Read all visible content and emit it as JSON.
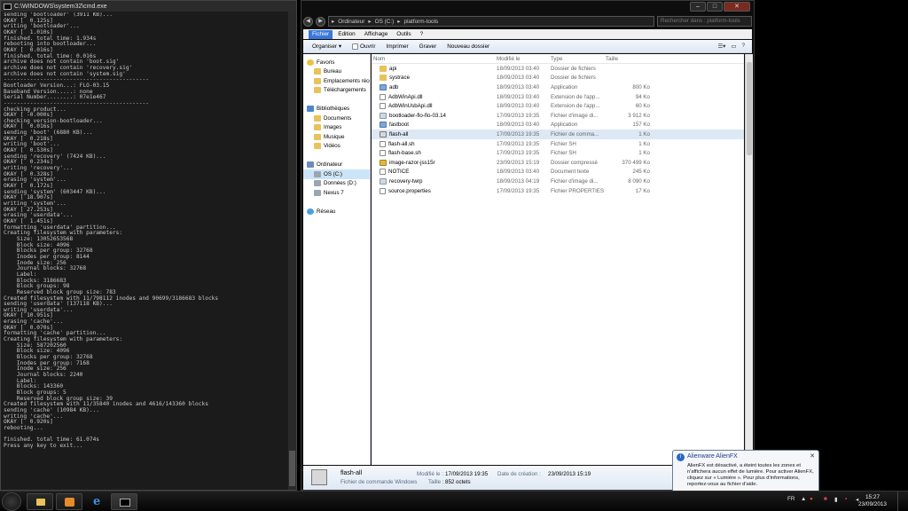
{
  "cmd": {
    "title": "C:\\WINDOWS\\system32\\cmd.exe",
    "lines": [
      "sending 'bootloader' (3911 KB)...",
      "OKAY [  0.125s]",
      "writing 'bootloader'...",
      "OKAY [  1.010s]",
      "finished. total time: 1.934s",
      "rebooting into bootloader...",
      "OKAY [  0.016s]",
      "finished. total time: 0.016s",
      "archive does not contain 'boot.sig'",
      "archive does not contain 'recovery.sig'",
      "archive does not contain 'system.sig'",
      "--------------------------------------------",
      "Bootloader Version...: FLO-03.15",
      "Baseband Version.....: none",
      "Serial Number........: 07e1e467",
      "--------------------------------------------",
      "checking product...",
      "OKAY [ -0.000s]",
      "checking version-bootloader...",
      "OKAY [  0.016s]",
      "sending 'boot' (6880 KB)...",
      "OKAY [  0.218s]",
      "writing 'boot'...",
      "OKAY [  0.530s]",
      "sending 'recovery' (7424 KB)...",
      "OKAY [  0.234s]",
      "writing 'recovery'...",
      "OKAY [  0.328s]",
      "erasing 'system'...",
      "OKAY [  0.172s]",
      "sending 'system' (603447 KB)...",
      "OKAY [ 18.907s]",
      "writing 'system'...",
      "OKAY [ 27.253s]",
      "erasing 'userdata'...",
      "OKAY [  1.451s]",
      "formatting 'userdata' partition...",
      "Creating filesystem with parameters:",
      "    Size: 13052653568",
      "    Block size: 4096",
      "    Blocks per group: 32768",
      "    Inodes per group: 8144",
      "    Inode size: 256",
      "    Journal blocks: 32768",
      "    Label:",
      "    Blocks: 3186683",
      "    Block groups: 98",
      "    Reserved block group size: 783",
      "Created filesystem with 11/798112 inodes and 90699/3186683 blocks",
      "sending 'userdata' (137118 KB)...",
      "writing 'userdata'...",
      "OKAY [ 10.951s]",
      "erasing 'cache'...",
      "OKAY [  0.070s]",
      "formatting 'cache' partition...",
      "Creating filesystem with parameters:",
      "    Size: 587202560",
      "    Block size: 4096",
      "    Blocks per group: 32768",
      "    Inodes per group: 7168",
      "    Inode size: 256",
      "    Journal blocks: 2240",
      "    Label:",
      "    Blocks: 143360",
      "    Block groups: 5",
      "    Reserved block group size: 39",
      "Created filesystem with 11/35840 inodes and 4616/143360 blocks",
      "sending 'cache' (10984 KB)...",
      "writing 'cache'...",
      "OKAY [  0.920s]",
      "rebooting...",
      "",
      "finished. total time: 61.074s",
      "Press any key to exit..."
    ]
  },
  "explorer": {
    "breadcrumb": [
      "Ordinateur",
      "OS (C:)",
      "platform-tools"
    ],
    "search_placeholder": "Rechercher dans : platform-tools",
    "menu": [
      "Fichier",
      "Edition",
      "Affichage",
      "Outils",
      "?"
    ],
    "toolbar": [
      "Organiser ▾",
      "Ouvrir",
      "Imprimer",
      "Graver",
      "Nouveau dossier"
    ],
    "nav": [
      {
        "label": "Favoris",
        "icon": "star-icon",
        "indent": 0
      },
      {
        "label": "Bureau",
        "icon": "folder-icon",
        "indent": 1
      },
      {
        "label": "Emplacements récents",
        "icon": "folder-icon",
        "indent": 1
      },
      {
        "label": "Téléchargements",
        "icon": "folder-icon",
        "indent": 1
      },
      {
        "label": "",
        "icon": "",
        "indent": 0
      },
      {
        "label": "Bibliothèques",
        "icon": "library-icon",
        "indent": 0
      },
      {
        "label": "Documents",
        "icon": "folder-icon",
        "indent": 1
      },
      {
        "label": "Images",
        "icon": "folder-icon",
        "indent": 1
      },
      {
        "label": "Musique",
        "icon": "folder-icon",
        "indent": 1
      },
      {
        "label": "Vidéos",
        "icon": "folder-icon",
        "indent": 1
      },
      {
        "label": "",
        "icon": "",
        "indent": 0
      },
      {
        "label": "Ordinateur",
        "icon": "computer-icon",
        "indent": 0
      },
      {
        "label": "OS (C:)",
        "icon": "drive-icon",
        "indent": 1,
        "selected": true
      },
      {
        "label": "Données (D:)",
        "icon": "drive-icon",
        "indent": 1
      },
      {
        "label": "Nexus 7",
        "icon": "drive-icon",
        "indent": 1
      },
      {
        "label": "",
        "icon": "",
        "indent": 0
      },
      {
        "label": "Réseau",
        "icon": "network-icon",
        "indent": 0
      }
    ],
    "columns": [
      "Nom",
      "Modifié le",
      "Type",
      "Taille"
    ],
    "files": [
      {
        "name": "api",
        "date": "18/09/2013 03:40",
        "type": "Dossier de fichiers",
        "size": "",
        "icon": "folder"
      },
      {
        "name": "systrace",
        "date": "18/09/2013 03:40",
        "type": "Dossier de fichiers",
        "size": "",
        "icon": "folder"
      },
      {
        "name": "adb",
        "date": "18/09/2013 03:40",
        "type": "Application",
        "size": "800 Ko",
        "icon": "app"
      },
      {
        "name": "AdbWinApi.dll",
        "date": "18/09/2013 03:40",
        "type": "Extension de l'app...",
        "size": "94 Ko",
        "icon": "doc"
      },
      {
        "name": "AdbWinUsbApi.dll",
        "date": "18/09/2013 03:40",
        "type": "Extension de l'app...",
        "size": "60 Ko",
        "icon": "doc"
      },
      {
        "name": "bootloader-flo-flo-03.14",
        "date": "17/09/2013 19:35",
        "type": "Fichier d'image di...",
        "size": "3 912 Ko",
        "icon": "img"
      },
      {
        "name": "fastboot",
        "date": "18/09/2013 03:40",
        "type": "Application",
        "size": "157 Ko",
        "icon": "app"
      },
      {
        "name": "flash-all",
        "date": "17/09/2013 19:35",
        "type": "Fichier de comma...",
        "size": "1 Ko",
        "icon": "bat",
        "selected": true
      },
      {
        "name": "flash-all.sh",
        "date": "17/09/2013 19:35",
        "type": "Fichier SH",
        "size": "1 Ko",
        "icon": "doc"
      },
      {
        "name": "flash-base.sh",
        "date": "17/09/2013 19:35",
        "type": "Fichier SH",
        "size": "1 Ko",
        "icon": "doc"
      },
      {
        "name": "image-razor-jss15r",
        "date": "23/09/2013 15:19",
        "type": "Dossier compressé",
        "size": "370 499 Ko",
        "icon": "zip"
      },
      {
        "name": "NOTICE",
        "date": "18/09/2013 03:40",
        "type": "Document texte",
        "size": "245 Ko",
        "icon": "doc"
      },
      {
        "name": "recovery-twrp",
        "date": "18/09/2013 04:19",
        "type": "Fichier d'image di...",
        "size": "8 090 Ko",
        "icon": "img"
      },
      {
        "name": "source.properties",
        "date": "17/09/2013 19:35",
        "type": "Fichier PROPERTIES",
        "size": "17 Ko",
        "icon": "doc"
      }
    ],
    "details": {
      "name": "flash-all",
      "kind": "Fichier de commande Windows",
      "modified_label": "Modifié le :",
      "modified_value": "17/09/2013 19:35",
      "created_label": "Date de création :",
      "created_value": "23/09/2013 15:19",
      "size_label": "Taille :",
      "size_value": "852 octets"
    }
  },
  "notification": {
    "title": "Alienware AlienFX",
    "body": "AlienFX est désactivé, a éteint toutes les zones et n'affichera aucun effet de lumière. Pour activer AlienFX, cliquez sur « Lumière ». Pour plus d'informations, reportez-vous au fichier d'aide."
  },
  "taskbar": {
    "lang": "FR",
    "time": "15:27",
    "date": "23/09/2013"
  }
}
